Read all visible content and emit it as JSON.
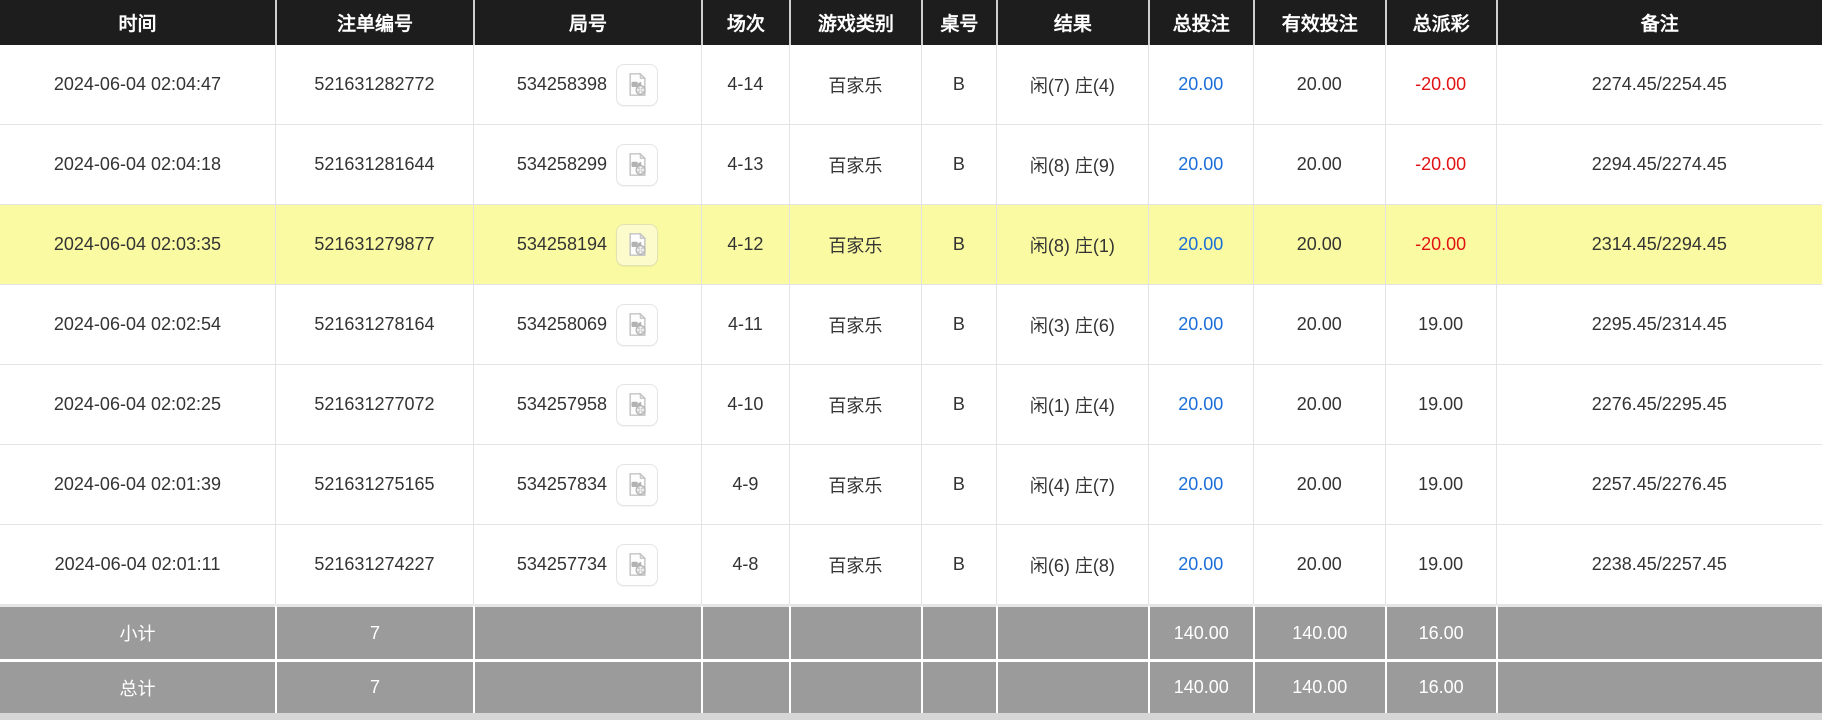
{
  "table": {
    "columns": [
      {
        "key": "time",
        "label": "时间"
      },
      {
        "key": "order_no",
        "label": "注单编号"
      },
      {
        "key": "round_no",
        "label": "局号"
      },
      {
        "key": "session",
        "label": "场次"
      },
      {
        "key": "game_type",
        "label": "游戏类别"
      },
      {
        "key": "table_no",
        "label": "桌号"
      },
      {
        "key": "result",
        "label": "结果"
      },
      {
        "key": "total_bet",
        "label": "总投注"
      },
      {
        "key": "valid_bet",
        "label": "有效投注"
      },
      {
        "key": "payout",
        "label": "总派彩"
      },
      {
        "key": "remark",
        "label": "备注"
      }
    ],
    "rows": [
      {
        "time": "2024-06-04 02:04:47",
        "order_no": "521631282772",
        "round_no": "534258398",
        "session": "4-14",
        "game_type": "百家乐",
        "table_no": "B",
        "result": "闲(7) 庄(4)",
        "total_bet": "20.00",
        "valid_bet": "20.00",
        "payout": "-20.00",
        "remark": "2274.45/2254.45",
        "highlighted": false
      },
      {
        "time": "2024-06-04 02:04:18",
        "order_no": "521631281644",
        "round_no": "534258299",
        "session": "4-13",
        "game_type": "百家乐",
        "table_no": "B",
        "result": "闲(8) 庄(9)",
        "total_bet": "20.00",
        "valid_bet": "20.00",
        "payout": "-20.00",
        "remark": "2294.45/2274.45",
        "highlighted": false
      },
      {
        "time": "2024-06-04 02:03:35",
        "order_no": "521631279877",
        "round_no": "534258194",
        "session": "4-12",
        "game_type": "百家乐",
        "table_no": "B",
        "result": "闲(8) 庄(1)",
        "total_bet": "20.00",
        "valid_bet": "20.00",
        "payout": "-20.00",
        "remark": "2314.45/2294.45",
        "highlighted": true
      },
      {
        "time": "2024-06-04 02:02:54",
        "order_no": "521631278164",
        "round_no": "534258069",
        "session": "4-11",
        "game_type": "百家乐",
        "table_no": "B",
        "result": "闲(3) 庄(6)",
        "total_bet": "20.00",
        "valid_bet": "20.00",
        "payout": "19.00",
        "remark": "2295.45/2314.45",
        "highlighted": false
      },
      {
        "time": "2024-06-04 02:02:25",
        "order_no": "521631277072",
        "round_no": "534257958",
        "session": "4-10",
        "game_type": "百家乐",
        "table_no": "B",
        "result": "闲(1) 庄(4)",
        "total_bet": "20.00",
        "valid_bet": "20.00",
        "payout": "19.00",
        "remark": "2276.45/2295.45",
        "highlighted": false
      },
      {
        "time": "2024-06-04 02:01:39",
        "order_no": "521631275165",
        "round_no": "534257834",
        "session": "4-9",
        "game_type": "百家乐",
        "table_no": "B",
        "result": "闲(4) 庄(7)",
        "total_bet": "20.00",
        "valid_bet": "20.00",
        "payout": "19.00",
        "remark": "2257.45/2276.45",
        "highlighted": false
      },
      {
        "time": "2024-06-04 02:01:11",
        "order_no": "521631274227",
        "round_no": "534257734",
        "session": "4-8",
        "game_type": "百家乐",
        "table_no": "B",
        "result": "闲(6) 庄(8)",
        "total_bet": "20.00",
        "valid_bet": "20.00",
        "payout": "19.00",
        "remark": "2238.45/2257.45",
        "highlighted": false
      }
    ],
    "subtotal": {
      "label": "小计",
      "count": "7",
      "total_bet": "140.00",
      "valid_bet": "140.00",
      "payout": "16.00"
    },
    "grand_total": {
      "label": "总计",
      "count": "7",
      "total_bet": "140.00",
      "valid_bet": "140.00",
      "payout": "16.00"
    }
  },
  "icons": {
    "video_icon": "video-file-icon"
  },
  "colors": {
    "header_bg": "#1d1d1d",
    "header_text": "#ffffff",
    "row_highlight": "#fafaa2",
    "bet_link_blue": "#1a6ed8",
    "negative_red": "#e01212",
    "footer_bg": "#9b9b9b",
    "border_gray": "#e3e3e3"
  }
}
